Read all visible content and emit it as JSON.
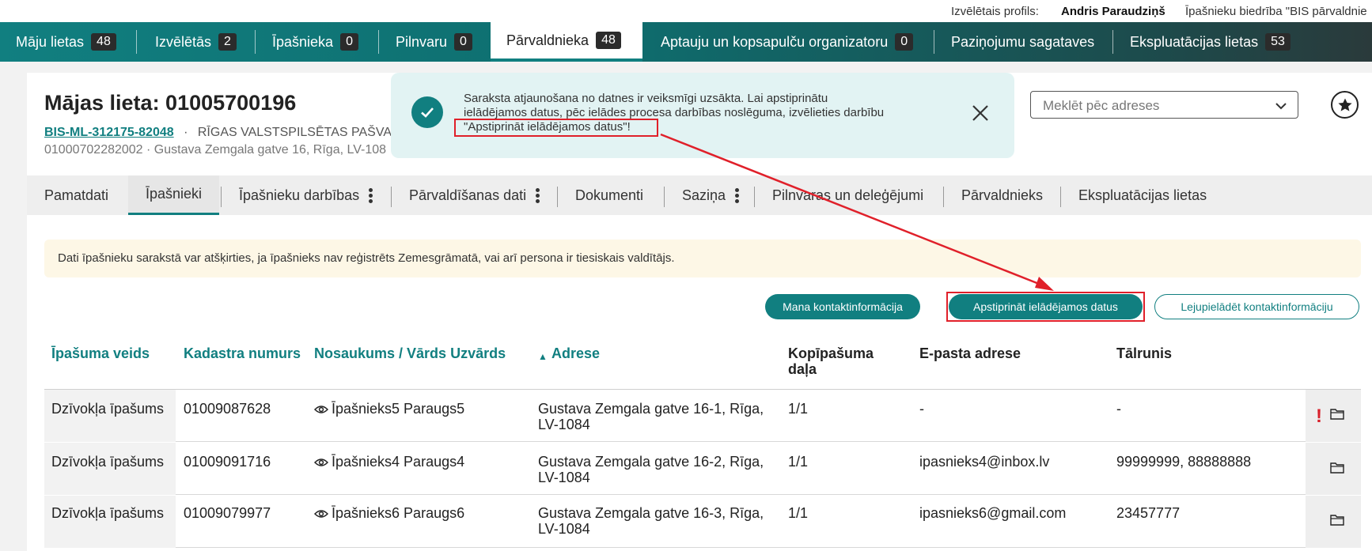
{
  "profile": {
    "label": "Izvēlētais profils:",
    "name": "Andris Paraudziņš",
    "org": "Īpašnieku biedrība \"BIS pārvaldnie"
  },
  "topnav": {
    "items": [
      {
        "label": "Māju lietas",
        "count": "48"
      },
      {
        "label": "Izvēlētās",
        "count": "2"
      },
      {
        "label": "Īpašnieka",
        "count": "0"
      },
      {
        "label": "Pilnvaru",
        "count": "0"
      },
      {
        "label": "Pārvaldnieka",
        "count": "48"
      },
      {
        "label": "Aptauju un kopsapulču organizatoru",
        "count": "0"
      },
      {
        "label": "Paziņojumu sagataves"
      },
      {
        "label": "Ekspluatācijas lietas",
        "count": "53"
      }
    ],
    "active_index": 4
  },
  "case": {
    "title": "Mājas lieta: 01005700196",
    "link": "BIS-ML-312175-82048",
    "dot": "·",
    "org": "RĪGAS VALSTSPILSĒTAS PAŠVA",
    "address_line": "01000702282002 · Gustava Zemgala gatve 16, Rīga, LV-108"
  },
  "toast": {
    "line1": "Saraksta atjaunošana no datnes ir veiksmīgi uzsākta. Lai apstiprinātu",
    "line2": "ielādējamos datus, pēc ielādes procesa darbības noslēguma, izvēlieties darbību",
    "line3": "\"Apstiprināt ielādējamos datus\"!"
  },
  "search": {
    "placeholder": "Meklēt pēc adreses"
  },
  "tabs": [
    {
      "label": "Pamatdati"
    },
    {
      "label": "Īpašnieki"
    },
    {
      "label": "Īpašnieku darbības"
    },
    {
      "label": "Pārvaldīšanas dati"
    },
    {
      "label": "Dokumenti"
    },
    {
      "label": "Saziņa"
    },
    {
      "label": "Pilnvaras un deleģējumi"
    },
    {
      "label": "Pārvaldnieks"
    },
    {
      "label": "Ekspluatācijas lietas"
    }
  ],
  "notice": "Dati īpašnieku sarakstā var atšķirties, ja īpašnieks nav reģistrēts Zemesgrāmatā, vai arī persona ir tiesiskais valdītājs.",
  "buttons": {
    "contact": "Mana kontaktinformācija",
    "confirm": "Apstiprināt ielādējamos datus",
    "download": "Lejupielādēt kontaktinformāciju"
  },
  "table": {
    "headers": {
      "type": "Īpašuma veids",
      "cadastre": "Kadastra numurs",
      "name": "Nosaukums / Vārds Uzvārds",
      "sort_arrow": "▲",
      "address": "Adrese",
      "share_1": "Kopīpašuma",
      "share_2": "daļa",
      "email": "E-pasta adrese",
      "phone": "Tālrunis"
    },
    "rows": [
      {
        "type": "Dzīvokļa īpašums",
        "cadastre": "01009087628",
        "name": "Īpašnieks5 Paraugs5",
        "address1": "Gustava Zemgala gatve 16-1, Rīga,",
        "address2": "LV-1084",
        "share": "1/1",
        "email": "-",
        "phone": "-",
        "warn": "!"
      },
      {
        "type": "Dzīvokļa īpašums",
        "cadastre": "01009091716",
        "name": "Īpašnieks4 Paraugs4",
        "address1": "Gustava Zemgala gatve 16-2, Rīga,",
        "address2": "LV-1084",
        "share": "1/1",
        "email": "ipasnieks4@inbox.lv",
        "phone": "99999999, 88888888"
      },
      {
        "type": "Dzīvokļa īpašums",
        "cadastre": "01009079977",
        "name": "Īpašnieks6 Paraugs6",
        "address1": "Gustava Zemgala gatve 16-3, Rīga,",
        "address2": "LV-1084",
        "share": "1/1",
        "email": "ipasnieks6@gmail.com",
        "phone": "23457777"
      }
    ]
  },
  "colors": {
    "accent": "#117f80",
    "annotation": "#e0202a",
    "notice_bg": "#fdf7e6",
    "toast_bg": "#e2f3f3"
  }
}
